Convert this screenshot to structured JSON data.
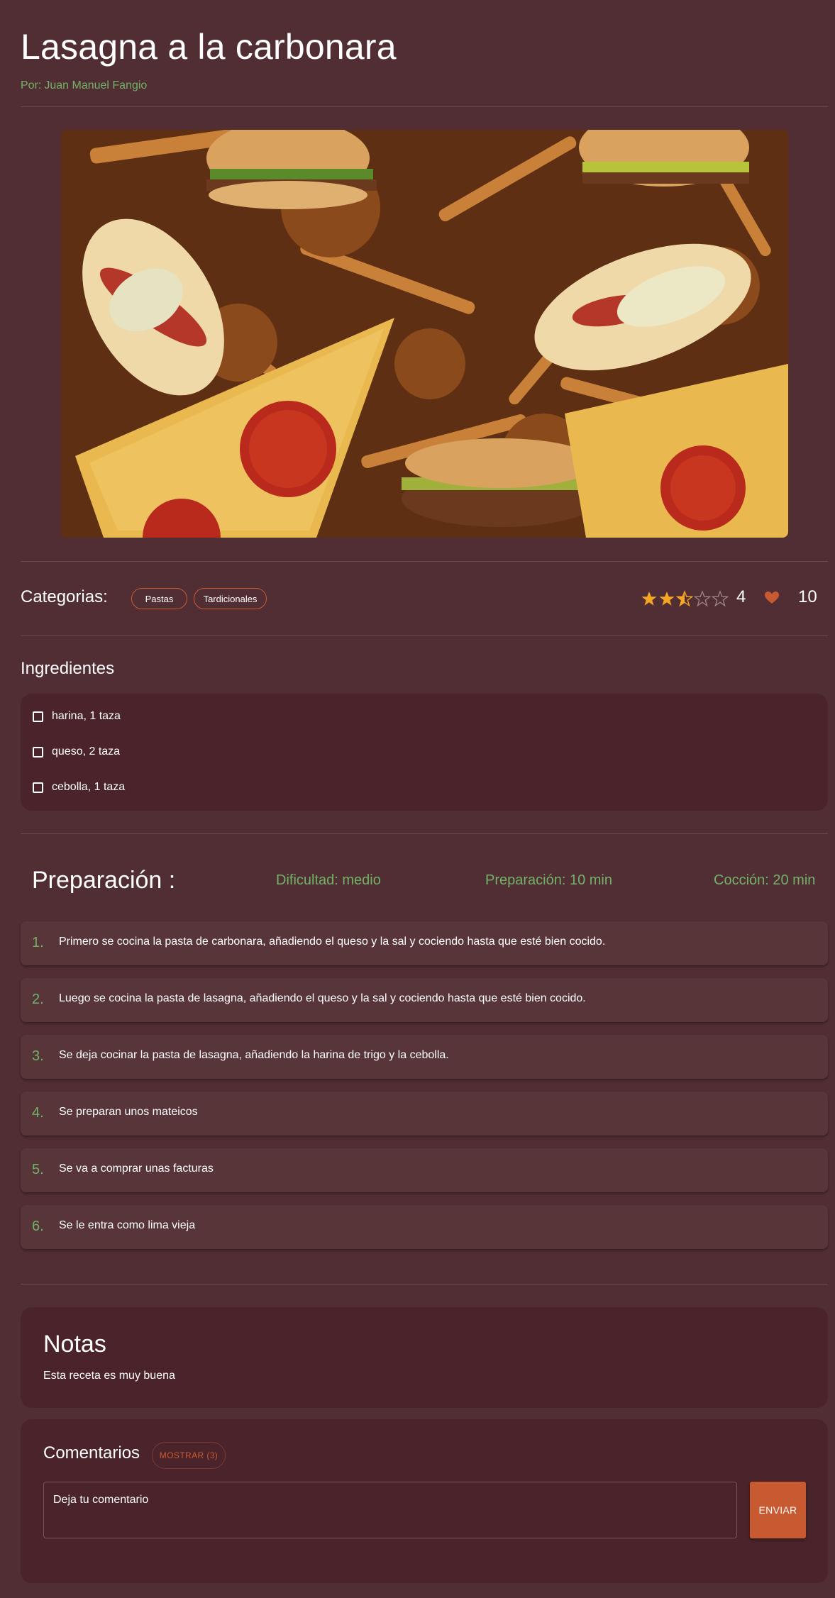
{
  "recipe": {
    "title": "Lasagna a la carbonara",
    "author_prefix": "Por:",
    "author_name": "Juan Manuel Fangio"
  },
  "categories": {
    "label": "Categorias:",
    "tags": [
      "Pastas",
      "Tardicionales"
    ]
  },
  "rating": {
    "stars_value": 2.5,
    "stars_max": 5,
    "count": "4"
  },
  "likes": {
    "icon": "heart-icon",
    "count": "10"
  },
  "ingredients": {
    "title": "Ingredientes",
    "items": [
      "harina, 1 taza",
      "queso, 2 taza",
      "cebolla, 1 taza"
    ]
  },
  "preparation": {
    "title": "Preparación :",
    "difficulty": "Dificultad: medio",
    "prep_time": "Preparación: 10 min",
    "cook_time": "Cocción: 20 min",
    "steps": [
      {
        "num": "1.",
        "text": "Primero se cocina la pasta de carbonara, añadiendo el queso y la sal y cociendo hasta que esté bien cocido."
      },
      {
        "num": "2.",
        "text": "Luego se cocina la pasta de lasagna, añadiendo el queso y la sal y cociendo hasta que esté bien cocido."
      },
      {
        "num": "3.",
        "text": "Se deja cocinar la pasta de lasagna, añadiendo la harina de trigo y la cebolla."
      },
      {
        "num": "4.",
        "text": "Se preparan unos mateicos"
      },
      {
        "num": "5.",
        "text": "Se va a comprar unas facturas"
      },
      {
        "num": "6.",
        "text": "Se le entra como lima vieja"
      }
    ]
  },
  "notes": {
    "title": "Notas",
    "text": "Esta receta es muy buena"
  },
  "comments": {
    "title": "Comentarios",
    "show_button": "MOSTRAR (3)",
    "placeholder": "Deja tu comentario",
    "value": "",
    "send_button": "ENVIAR"
  },
  "colors": {
    "background": "#512e33",
    "card": "#4a242a",
    "accent": "#c85a32",
    "green": "#71b267",
    "star": "#f5a623"
  }
}
